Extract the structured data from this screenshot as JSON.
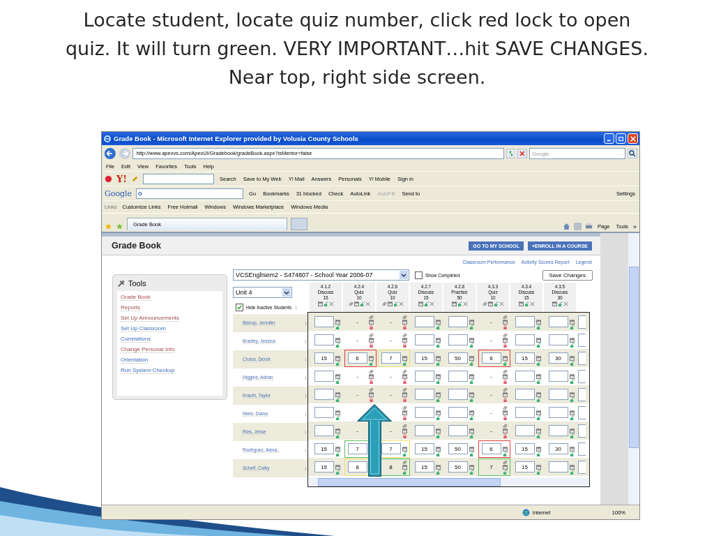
{
  "slide": {
    "title": "Locate student, locate quiz number, click red lock to open quiz. It will turn green. VERY IMPORTANT…hit SAVE CHANGES. Near top, right side screen."
  },
  "browser": {
    "title": "Grade Book - Microsoft Internet Explorer provided by Volusia County Schools",
    "address": "http://www.apexvs.com/ApexUI/Gradebook/gradeBook.aspx?isMentor=false",
    "search_placeholder": "Google",
    "menu": [
      "File",
      "Edit",
      "View",
      "Favorites",
      "Tools",
      "Help"
    ],
    "yahoo": {
      "logo": "Y!",
      "search": "Search",
      "items": [
        "Save to My Web",
        "Y! Mail",
        "Answers",
        "Personals",
        "Y! Mobile",
        "Sign in"
      ]
    },
    "google": {
      "logo": "Google",
      "field": "G",
      "go": "Go",
      "settings": "Settings",
      "items": [
        {
          "label": "Bookmarks",
          "disabled": false
        },
        {
          "label": "31 blocked",
          "disabled": false
        },
        {
          "label": "Check",
          "disabled": false
        },
        {
          "label": "AutoLink",
          "disabled": false
        },
        {
          "label": "AutoFill",
          "disabled": true
        },
        {
          "label": "Send to",
          "disabled": false
        }
      ]
    },
    "links_label": "Links",
    "links": [
      "Customize Links",
      "Free Hotmail",
      "Windows",
      "Windows Marketplace",
      "Windows Media"
    ],
    "tab": "Grade Book",
    "commands": [
      "Page",
      "Tools"
    ],
    "more": "»",
    "status": {
      "zone": "Internet",
      "zoom": "100%"
    }
  },
  "page": {
    "heading": "Grade Book",
    "buttons": [
      "GO TO MY SCHOOL",
      "+ENROLL IN A COURSE"
    ],
    "links": [
      "Classroom Performance",
      "Activity Scores Report",
      "Legend"
    ],
    "tools": {
      "title": "Tools",
      "items": [
        {
          "label": "Grade Book",
          "visited": true
        },
        {
          "label": "Reports",
          "visited": true
        },
        {
          "label": "Set Up Announcements",
          "visited": true
        },
        {
          "label": "Set Up Classroom",
          "visited": false
        },
        {
          "label": "Correlations",
          "visited": false
        },
        {
          "label": "Change Personal Info",
          "visited": true
        },
        {
          "label": "Orientation",
          "visited": false
        },
        {
          "label": "Run System Checkup",
          "visited": false
        }
      ]
    },
    "course": "VCSEnglIsem2 - S474807 - School Year 2006-07",
    "unit": "Unit 4",
    "show_completed": {
      "label": "Show Completed",
      "checked": false
    },
    "hide_inactive": {
      "label": "Hide Inactive Students",
      "checked": true,
      "info": "i"
    },
    "save": "Save Changes",
    "columns": [
      {
        "number": "4.1.2",
        "type": "Discuss",
        "points": "15",
        "lockable": false
      },
      {
        "number": "4.2.4",
        "type": "Quiz",
        "points": "10",
        "lockable": true
      },
      {
        "number": "4.2.6",
        "type": "Quiz",
        "points": "10",
        "lockable": true
      },
      {
        "number": "4.2.7",
        "type": "Discuss",
        "points": "15",
        "lockable": false
      },
      {
        "number": "4.2.8",
        "type": "Practice",
        "points": "50",
        "lockable": false
      },
      {
        "number": "4.3.3",
        "type": "Quiz",
        "points": "10",
        "lockable": true
      },
      {
        "number": "4.3.4",
        "type": "Discuss",
        "points": "15",
        "lockable": false
      },
      {
        "number": "4.3.5",
        "type": "Discuss",
        "points": "30",
        "lockable": false
      }
    ],
    "students": [
      {
        "name": "Bishop, Jennifer",
        "info": "i",
        "cells": [
          {
            "kind": "input",
            "locked": false
          },
          {
            "kind": "fixed",
            "value": "-",
            "locked": true
          },
          {
            "kind": "fixed",
            "value": "-",
            "locked": true
          },
          {
            "kind": "input",
            "locked": false
          },
          {
            "kind": "input",
            "locked": false
          },
          {
            "kind": "fixed",
            "value": "-",
            "locked": true
          },
          {
            "kind": "input",
            "locked": false
          },
          {
            "kind": "input",
            "locked": false
          }
        ]
      },
      {
        "name": "Bradley, Jessica",
        "info": "i",
        "cells": [
          {
            "kind": "input",
            "locked": false
          },
          {
            "kind": "fixed",
            "value": "-",
            "locked": true
          },
          {
            "kind": "fixed",
            "value": "-",
            "locked": true
          },
          {
            "kind": "input",
            "locked": false
          },
          {
            "kind": "input",
            "locked": false
          },
          {
            "kind": "fixed",
            "value": "-",
            "locked": true
          },
          {
            "kind": "input",
            "locked": false
          },
          {
            "kind": "input",
            "locked": false
          }
        ]
      },
      {
        "name": "Cruice, Derek",
        "info": "i",
        "cells": [
          {
            "kind": "input",
            "value": "15",
            "locked": false
          },
          {
            "kind": "input",
            "value": "6",
            "locked": false,
            "color": "#e03c3c"
          },
          {
            "kind": "input",
            "value": "7",
            "locked": false,
            "color": "#f0e070"
          },
          {
            "kind": "input",
            "value": "15",
            "locked": false
          },
          {
            "kind": "input",
            "value": "50",
            "locked": false
          },
          {
            "kind": "input",
            "value": "6",
            "locked": false,
            "color": "#e03c3c"
          },
          {
            "kind": "input",
            "value": "15",
            "locked": false
          },
          {
            "kind": "input",
            "value": "30",
            "locked": false
          }
        ]
      },
      {
        "name": "Higgins, Adrian",
        "info": "i",
        "cells": [
          {
            "kind": "input",
            "locked": false
          },
          {
            "kind": "fixed",
            "value": "-",
            "locked": true
          },
          {
            "kind": "fixed",
            "value": "-",
            "locked": true
          },
          {
            "kind": "input",
            "locked": false
          },
          {
            "kind": "input",
            "locked": false
          },
          {
            "kind": "fixed",
            "value": "-",
            "locked": true
          },
          {
            "kind": "input",
            "locked": false
          },
          {
            "kind": "input",
            "locked": false
          }
        ]
      },
      {
        "name": "Krauth, Taylor",
        "info": "i",
        "cells": [
          {
            "kind": "input",
            "locked": false
          },
          {
            "kind": "fixed",
            "value": "-",
            "locked": true
          },
          {
            "kind": "fixed",
            "value": "-",
            "locked": true
          },
          {
            "kind": "input",
            "locked": false
          },
          {
            "kind": "input",
            "locked": false
          },
          {
            "kind": "fixed",
            "value": "-",
            "locked": true
          },
          {
            "kind": "input",
            "locked": false
          },
          {
            "kind": "input",
            "locked": false
          }
        ]
      },
      {
        "name": "Nieto, Diana",
        "info": "i",
        "cells": [
          {
            "kind": "input",
            "locked": false
          },
          {
            "kind": "covered"
          },
          {
            "kind": "fixed",
            "locked": true
          },
          {
            "kind": "input",
            "locked": false
          },
          {
            "kind": "input",
            "locked": false
          },
          {
            "kind": "fixed",
            "value": "-",
            "locked": true
          },
          {
            "kind": "input",
            "locked": false
          },
          {
            "kind": "input",
            "locked": false
          }
        ]
      },
      {
        "name": "Ries, Jesse",
        "info": "i",
        "cells": [
          {
            "kind": "input",
            "locked": false
          },
          {
            "kind": "covered",
            "value": "-"
          },
          {
            "kind": "fixed",
            "value": "-",
            "locked": true
          },
          {
            "kind": "input",
            "locked": false
          },
          {
            "kind": "input",
            "locked": false
          },
          {
            "kind": "fixed",
            "value": "-",
            "locked": true
          },
          {
            "kind": "input",
            "locked": false
          },
          {
            "kind": "input",
            "locked": false
          }
        ]
      },
      {
        "name": "Rodriguez, Alexa..",
        "info": "i",
        "cells": [
          {
            "kind": "input",
            "value": "15",
            "locked": false
          },
          {
            "kind": "covered-input",
            "value": "7",
            "color": "#5cc05c"
          },
          {
            "kind": "input",
            "value": "7",
            "locked": false,
            "color": "#f0e070"
          },
          {
            "kind": "input",
            "value": "15",
            "locked": false
          },
          {
            "kind": "input",
            "value": "50",
            "locked": false
          },
          {
            "kind": "input",
            "value": "6",
            "locked": false,
            "color": "#e03c3c"
          },
          {
            "kind": "input",
            "value": "15",
            "locked": false
          },
          {
            "kind": "input",
            "value": "30",
            "locked": false
          }
        ]
      },
      {
        "name": "Scheff, Colby",
        "info": "i",
        "cells": [
          {
            "kind": "input",
            "value": "15",
            "locked": false
          },
          {
            "kind": "covered-input",
            "value": "8",
            "color": "#f0e070"
          },
          {
            "kind": "fixed",
            "value": "8",
            "locked": false,
            "color": "#5cc05c"
          },
          {
            "kind": "input",
            "value": "15",
            "locked": false
          },
          {
            "kind": "input",
            "value": "50",
            "locked": false
          },
          {
            "kind": "fixed",
            "value": "7",
            "locked": false,
            "color": "#5cc05c"
          },
          {
            "kind": "input",
            "value": "15",
            "locked": false
          },
          {
            "kind": "input",
            "locked": false
          }
        ]
      }
    ]
  }
}
